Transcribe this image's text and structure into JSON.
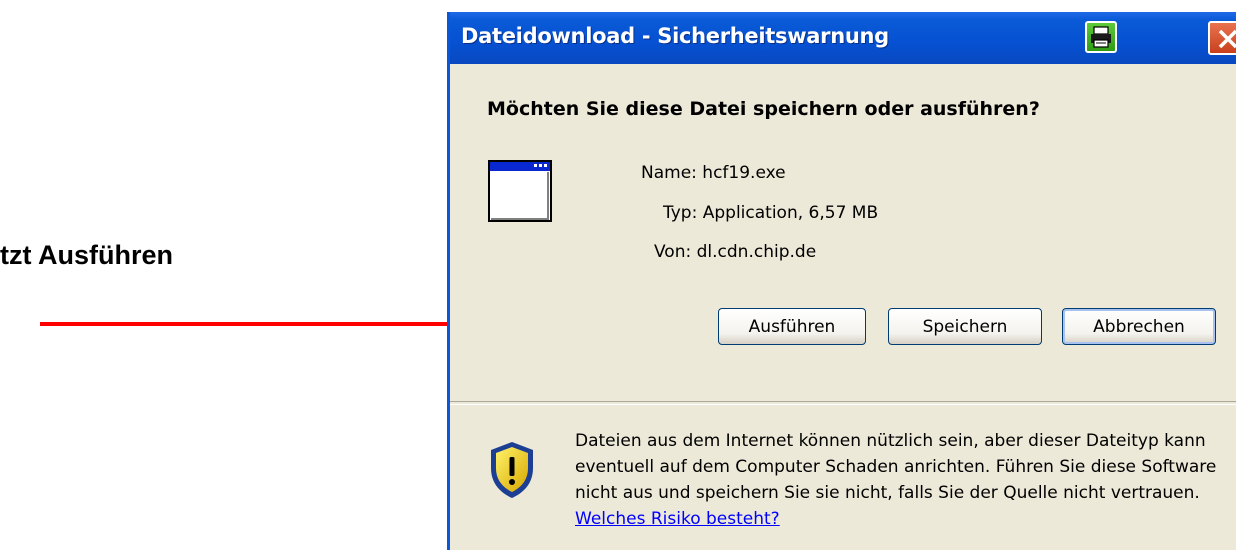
{
  "annotation": {
    "text": "tzt Ausführen",
    "arrow_color": "#ff0000"
  },
  "dialog": {
    "title": "Dateidownload - Sicherheitswarnung",
    "title_buttons": [
      "printer-icon",
      "close-icon"
    ],
    "question": "Möchten Sie diese Datei speichern oder ausführen?",
    "file_icon": "application-window-icon",
    "info": {
      "name_label": "Name:",
      "name_value": "hcf19.exe",
      "type_label": "Typ:",
      "type_value": "Application, 6,57 MB",
      "from_label": "Von:",
      "from_value": "dl.cdn.chip.de"
    },
    "buttons": {
      "run": "Ausführen",
      "save": "Speichern",
      "cancel": "Abbrechen"
    },
    "warning": {
      "icon": "security-shield-warning-icon",
      "text": "Dateien aus dem Internet können nützlich sein, aber dieser Dateityp kann eventuell auf dem Computer Schaden anrichten. Führen Sie diese Software nicht aus und speichern Sie sie nicht, falls Sie der Quelle nicht vertrauen. ",
      "link": "Welches Risiko besteht?"
    }
  },
  "colors": {
    "titlebar": "#0551d2",
    "dialog_bg": "#ece9d8",
    "link": "#0000ff"
  }
}
